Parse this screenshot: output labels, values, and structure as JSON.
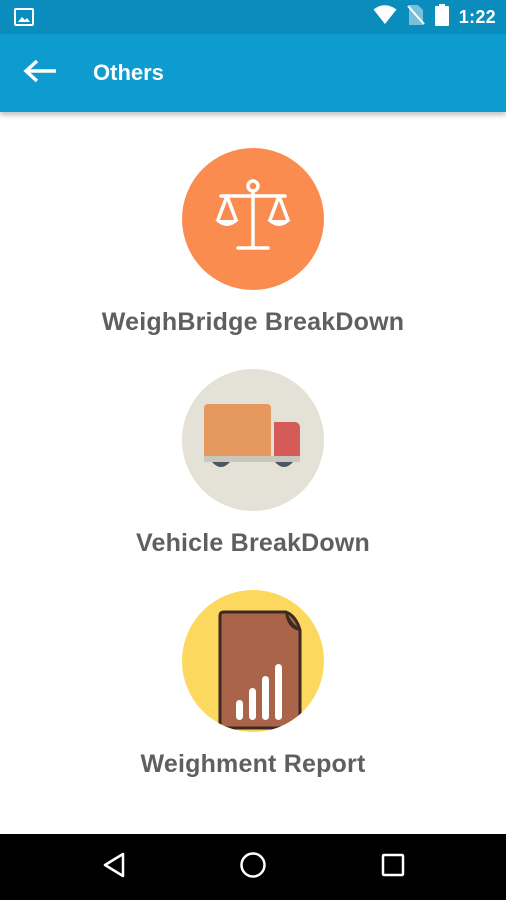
{
  "status_bar": {
    "time": "1:22",
    "icons": [
      "image-icon",
      "wifi-icon",
      "no-sim-icon",
      "battery-icon"
    ]
  },
  "app_bar": {
    "title": "Others",
    "back_icon": "arrow-back-icon",
    "background": "#0e9bcf"
  },
  "menu": {
    "items": [
      {
        "label": "WeighBridge BreakDown",
        "icon": "scale-icon",
        "circle_color": "#fb8c4f"
      },
      {
        "label": "Vehicle BreakDown",
        "icon": "truck-icon",
        "circle_color": "#e4e2d7"
      },
      {
        "label": "Weighment Report",
        "icon": "report-icon",
        "circle_color": "#fcd95e"
      }
    ]
  },
  "nav_bar": {
    "icons": [
      "back-triangle-icon",
      "home-circle-icon",
      "recents-square-icon"
    ]
  }
}
